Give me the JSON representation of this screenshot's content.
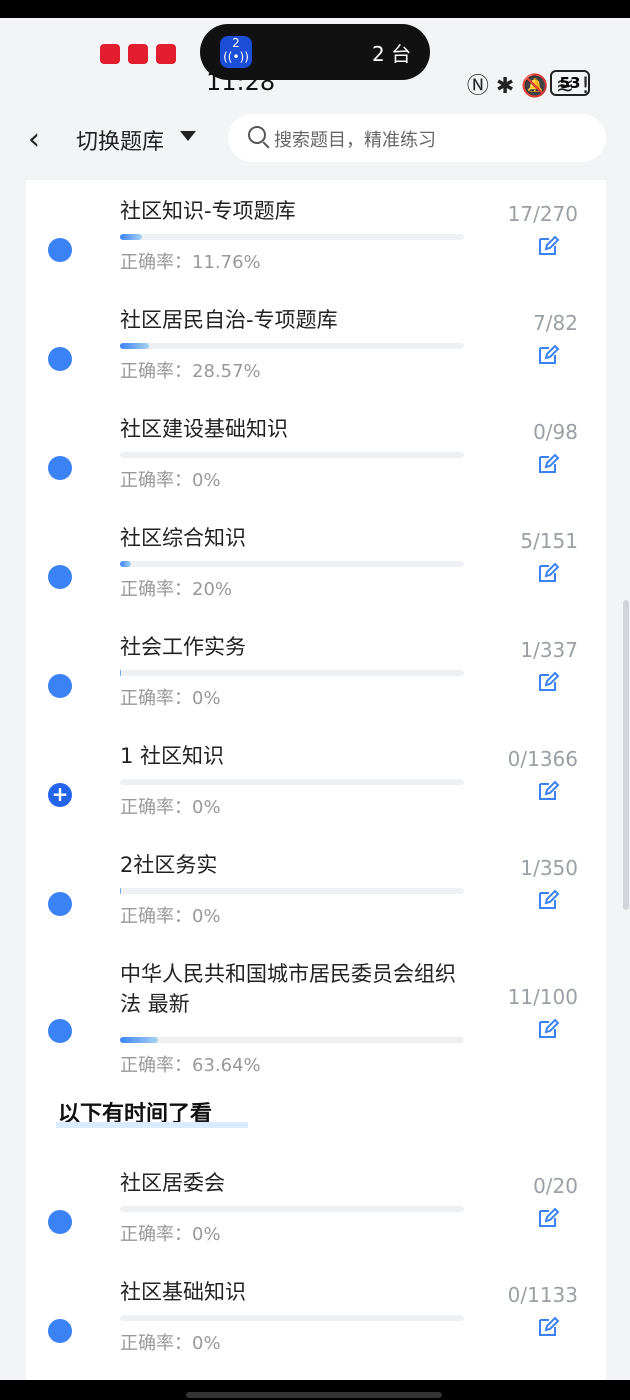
{
  "statusbar": {
    "time": "11:28",
    "pill_count": "2",
    "pill_text": "2 台",
    "battery": "53"
  },
  "header": {
    "switch_label": "切换题库",
    "search_placeholder": "搜索题目，精准练习"
  },
  "items": [
    {
      "title": "社区知识-专项题库",
      "accuracy": "正确率：11.76%",
      "count": "17/270",
      "progress": 0.063
    },
    {
      "title": "社区居民自治-专项题库",
      "accuracy": "正确率：28.57%",
      "count": "7/82",
      "progress": 0.085
    },
    {
      "title": "社区建设基础知识",
      "accuracy": "正确率：0%",
      "count": "0/98",
      "progress": 0
    },
    {
      "title": "社区综合知识",
      "accuracy": "正确率：20%",
      "count": "5/151",
      "progress": 0.033
    },
    {
      "title": "社会工作实务",
      "accuracy": "正确率：0%",
      "count": "1/337",
      "progress": 0.003
    },
    {
      "title": "1 社区知识",
      "accuracy": "正确率：0%",
      "count": "0/1366",
      "progress": 0
    },
    {
      "title": "2社区务实",
      "accuracy": "正确率：0%",
      "count": "1/350",
      "progress": 0.003
    },
    {
      "title": "中华人民共和国城市居民委员会组织法 最新",
      "accuracy": "正确率：63.64%",
      "count": "11/100",
      "progress": 0.11
    }
  ],
  "section_title": "以下有时间了看",
  "items2": [
    {
      "title": "社区居委会",
      "accuracy": "正确率：0%",
      "count": "0/20",
      "progress": 0
    },
    {
      "title": "社区基础知识",
      "accuracy": "正确率：0%",
      "count": "0/1133",
      "progress": 0
    }
  ]
}
